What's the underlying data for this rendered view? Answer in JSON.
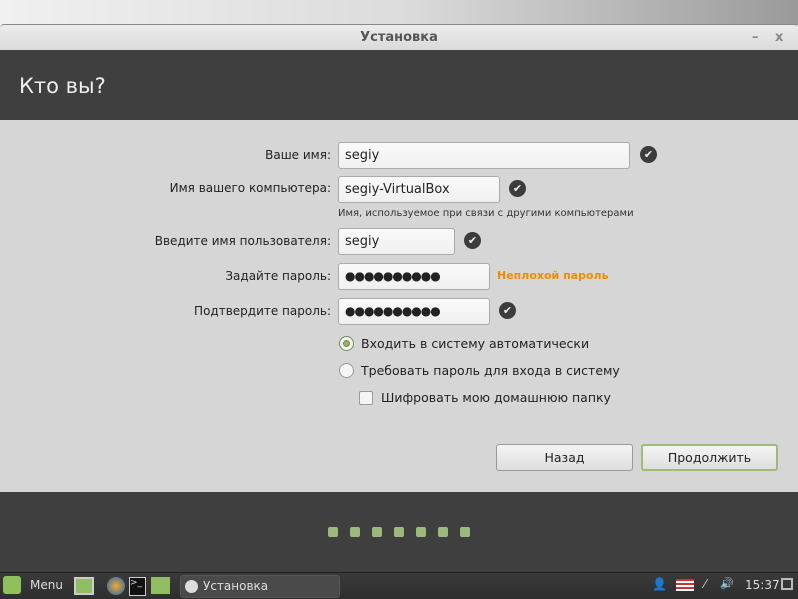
{
  "window": {
    "title": "Установка",
    "minimize": "–",
    "close": "x"
  },
  "header": {
    "title": "Кто вы?"
  },
  "form": {
    "name_label": "Ваше имя:",
    "name_value": "segiy",
    "computer_label": "Имя вашего компьютера:",
    "computer_value": "segiy-VirtualBox",
    "computer_hint": "Имя, используемое при связи с другими компьютерами",
    "user_label": "Введите имя пользователя:",
    "user_value": "segiy",
    "password_label": "Задайте пароль:",
    "password_value": "●●●●●●●●●●",
    "password_strength": "Неплохой пароль",
    "confirm_label": "Подтвердите пароль:",
    "confirm_value": "●●●●●●●●●●",
    "auto_login": "Входить в систему автоматически",
    "require_password": "Требовать пароль для входа в систему",
    "encrypt_home": "Шифровать мою домашнюю папку",
    "selected_login_option": "auto_login",
    "encrypt_checked": false
  },
  "buttons": {
    "back": "Назад",
    "continue": "Продолжить"
  },
  "progress": {
    "steps": 7,
    "colors": {
      "step": "#9ab97a"
    }
  },
  "taskbar": {
    "menu": "Menu",
    "task": "Установка",
    "clock": "15:37"
  }
}
